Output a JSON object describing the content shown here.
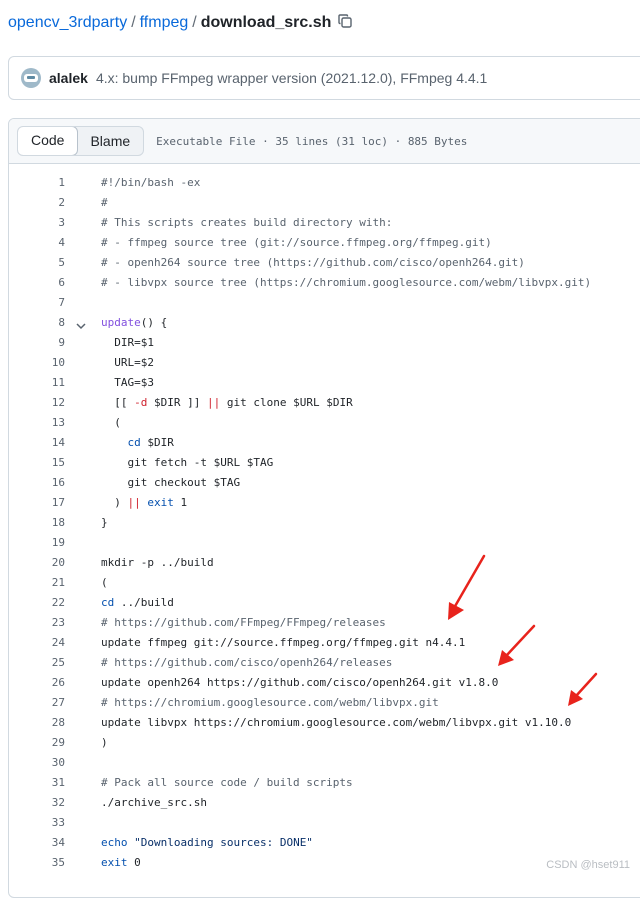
{
  "breadcrumb": {
    "repo": "opencv_3rdparty",
    "folder": "ffmpeg",
    "file": "download_src.sh",
    "separator": "/"
  },
  "commit": {
    "author": "alalek",
    "message": "4.x: bump FFmpeg wrapper version (2021.12.0), FFmpeg 4.4.1"
  },
  "file_header": {
    "code_tab": "Code",
    "blame_tab": "Blame",
    "info": "Executable File · 35 lines (31 loc) · 885 Bytes"
  },
  "code": {
    "lines": [
      "#!/bin/bash -ex",
      "#",
      "# This scripts creates build directory with:",
      "# - ffmpeg source tree (git://source.ffmpeg.org/ffmpeg.git)",
      "# - openh264 source tree (https://github.com/cisco/openh264.git)",
      "# - libvpx source tree (https://chromium.googlesource.com/webm/libvpx.git)",
      "",
      "update() {",
      "  DIR=$1",
      "  URL=$2",
      "  TAG=$3",
      "  [[ -d $DIR ]] || git clone $URL $DIR",
      "  (",
      "    cd $DIR",
      "    git fetch -t $URL $TAG",
      "    git checkout $TAG",
      "  ) || exit 1",
      "}",
      "",
      "mkdir -p ../build",
      "(",
      "cd ../build",
      "# https://github.com/FFmpeg/FFmpeg/releases",
      "update ffmpeg git://source.ffmpeg.org/ffmpeg.git n4.4.1",
      "# https://github.com/cisco/openh264/releases",
      "update openh264 https://github.com/cisco/openh264.git v1.8.0",
      "# https://chromium.googlesource.com/webm/libvpx.git",
      "update libvpx https://chromium.googlesource.com/webm/libvpx.git v1.10.0",
      ")",
      "",
      "# Pack all source code / build scripts",
      "./archive_src.sh",
      "",
      "echo \"Downloading sources: DONE\"",
      "exit 0"
    ],
    "foldable_line": 8
  },
  "watermark": "CSDN @hset911",
  "colors": {
    "link": "#0969da",
    "keyword": "#0550ae",
    "function": "#8250df",
    "operator": "#cf222e",
    "string": "#0a3069",
    "comment": "#59636e",
    "annotation_arrow": "#e8231c"
  },
  "icons": {
    "copy": "copy-icon",
    "fold": "chevron-down-icon",
    "avatar": "avatar"
  }
}
